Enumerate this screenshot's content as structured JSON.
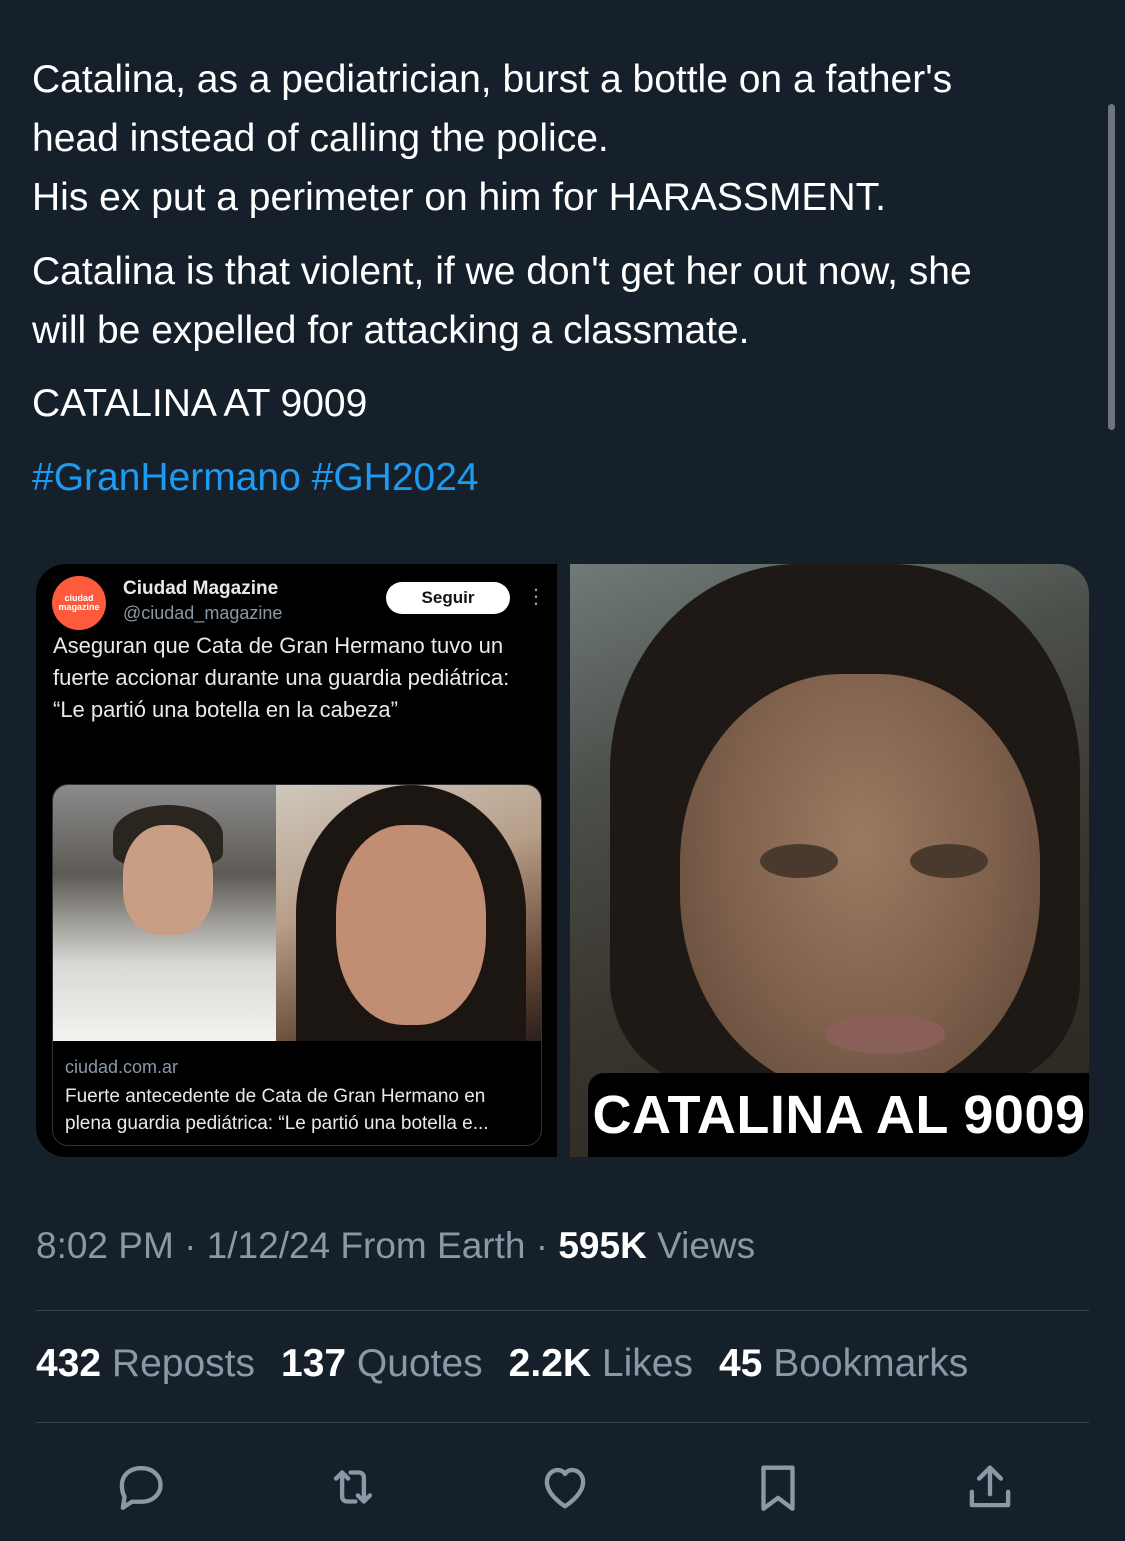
{
  "tweet": {
    "text_p1_l1": "Catalina, as a pediatrician, burst a bottle on a father's",
    "text_p1_l2": "head instead of calling the police.",
    "text_p1_l3": "His ex put a perimeter on him for HARASSMENT.",
    "text_p2_l1": "Catalina is that violent, if we don't get her out now, she",
    "text_p2_l2": "will be expelled for attacking a classmate.",
    "text_p3": "CATALINA AT 9009",
    "hashtags": [
      "#GranHermano",
      "#GH2024"
    ]
  },
  "embedded": {
    "avatar_text": "ciudad magazine",
    "name": "Ciudad Magazine",
    "handle": "@ciudad_magazine",
    "follow_label": "Seguir",
    "text": "Aseguran que Cata de Gran Hermano tuvo un fuerte accionar durante una guardia pediátrica: “Le partió una botella en la cabeza”",
    "card_domain": "ciudad.com.ar",
    "card_title": "Fuerte antecedente de Cata de Gran Hermano en plena guardia pediátrica: “Le partió una botella e..."
  },
  "right_image": {
    "caption": "CATALINA AL 9009"
  },
  "meta": {
    "time": "8:02 PM",
    "date": "1/12/24",
    "source": "From Earth",
    "views_count": "595K",
    "views_label": "Views"
  },
  "stats": [
    {
      "count": "432",
      "label": "Reposts"
    },
    {
      "count": "137",
      "label": "Quotes"
    },
    {
      "count": "2.2K",
      "label": "Likes"
    },
    {
      "count": "45",
      "label": "Bookmarks"
    }
  ],
  "icons": {
    "reply": "reply-icon",
    "retweet": "retweet-icon",
    "like": "heart-icon",
    "bookmark": "bookmark-icon",
    "share": "share-icon"
  },
  "colors": {
    "background": "#15202b",
    "accent": "#1d9bf0",
    "secondary_text": "#8b98a5"
  }
}
